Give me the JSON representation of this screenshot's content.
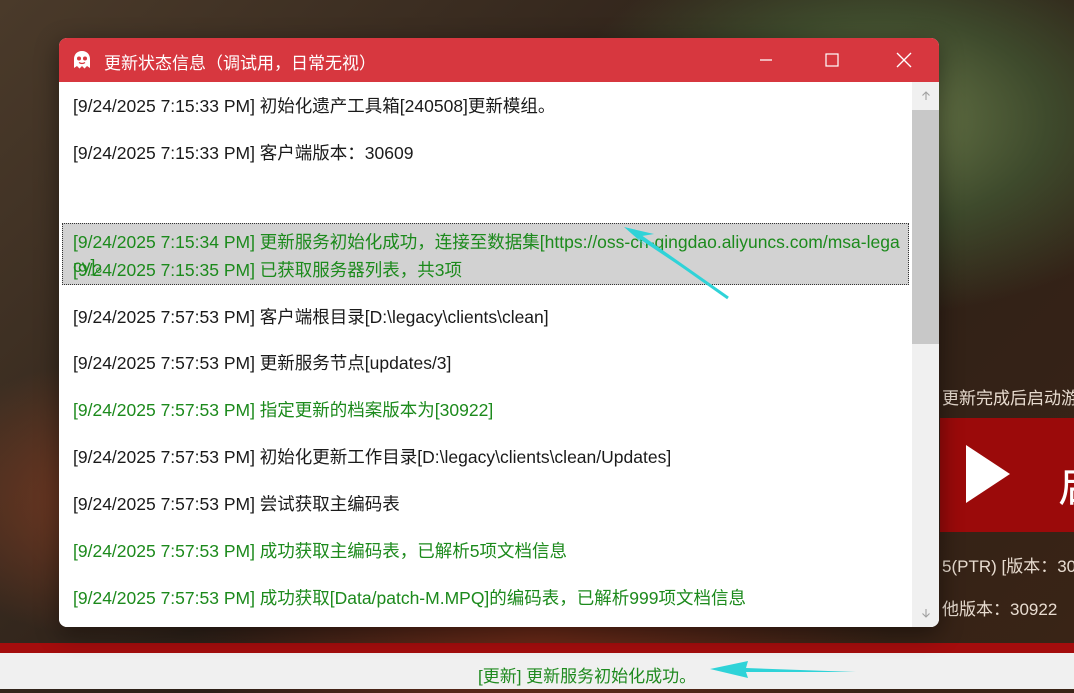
{
  "window": {
    "title": "更新状态信息（调试用，日常无视）",
    "accent": "#d7373f"
  },
  "log": {
    "rows": [
      {
        "text": "[9/24/2025 7:15:33 PM] 初始化遗产工具箱[240508]更新模组。",
        "color": "black"
      },
      {
        "text": "[9/24/2025 7:15:33 PM] 客户端版本：30609",
        "color": "black"
      },
      {
        "text": "[9/24/2025 7:15:34 PM] 更新服务初始化成功，连接至数据集[https://oss-cn-qingdao.aliyuncs.com/msa-legacy]。",
        "color": "green",
        "selected": true
      },
      {
        "text": "[9/24/2025 7:15:35 PM] 已获取服务器列表，共3项",
        "color": "green"
      },
      {
        "text": "[9/24/2025 7:57:53 PM] 客户端根目录[D:\\legacy\\clients\\clean]",
        "color": "black"
      },
      {
        "text": "[9/24/2025 7:57:53 PM] 更新服务节点[updates/3]",
        "color": "black"
      },
      {
        "text": "[9/24/2025 7:57:53 PM] 指定更新的档案版本为[30922]",
        "color": "green"
      },
      {
        "text": "[9/24/2025 7:57:53 PM] 初始化更新工作目录[D:\\legacy\\clients\\clean/Updates]",
        "color": "black"
      },
      {
        "text": "[9/24/2025 7:57:53 PM] 尝试获取主编码表",
        "color": "black"
      },
      {
        "text": "[9/24/2025 7:57:53 PM] 成功获取主编码表，已解析5项文档信息",
        "color": "green"
      },
      {
        "text": "[9/24/2025 7:57:53 PM] 成功获取[Data/patch-M.MPQ]的编码表，已解析999项文档信息",
        "color": "green"
      }
    ]
  },
  "background": {
    "launch_note": "更新完成后启动游",
    "play_label": "启",
    "version_line": "5(PTR) [版本：30",
    "other_version": "他版本：30922"
  },
  "statusbar": {
    "text": "[更新] 更新服务初始化成功。"
  },
  "icons": {
    "app": "ghost-icon",
    "minimize": "minimize-icon",
    "maximize": "maximize-icon",
    "close": "close-icon",
    "scroll_up": "scroll-up-arrow-icon",
    "scroll_down": "scroll-down-arrow-icon",
    "play": "play-icon",
    "annotation": "annotation-arrow-icon"
  },
  "colors": {
    "green": "#1c8a1c",
    "black": "#1a1a1a",
    "annotation": "#2fd3d8",
    "brand_red": "#9b0a0a"
  }
}
